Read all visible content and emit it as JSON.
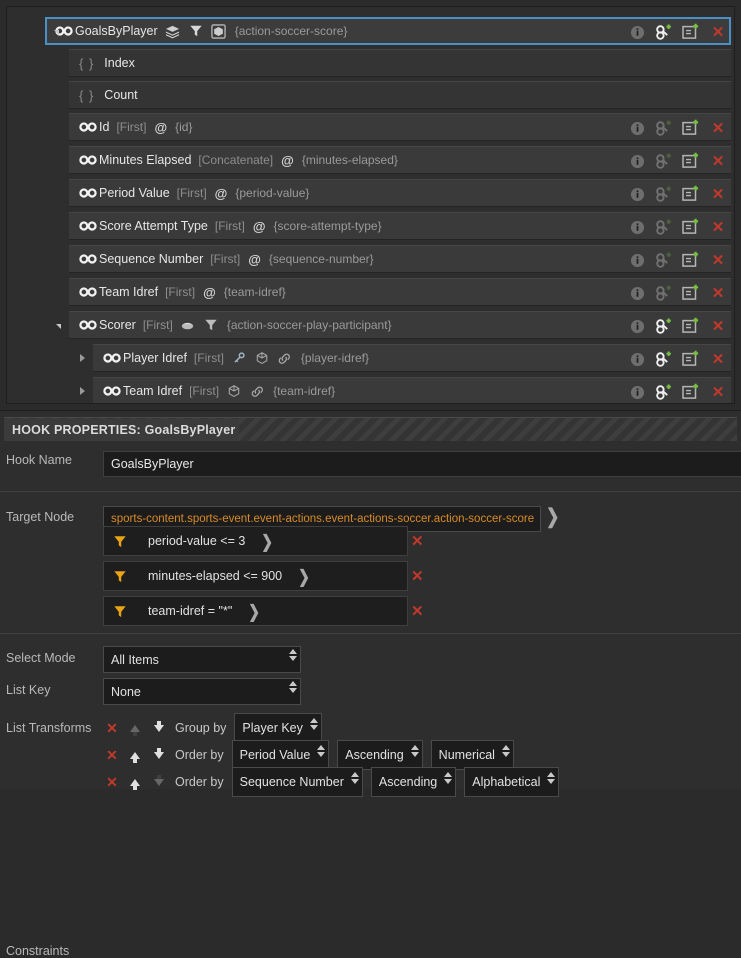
{
  "tree": {
    "root": {
      "label": "GoalsByPlayer",
      "icons": [
        "link-chain-icon",
        "layers-icon",
        "filter-icon",
        "box-icon"
      ],
      "xpath": "{action-soccer-score}",
      "selected": true,
      "expanded": true
    },
    "rows": [
      {
        "kind": "braces",
        "braces": "{ }",
        "label": "Index",
        "indent": 1,
        "actions": false
      },
      {
        "kind": "braces",
        "braces": "{ }",
        "label": "Count",
        "indent": 1,
        "actions": false
      },
      {
        "kind": "field",
        "label": "Id",
        "agg": "[First]",
        "at": "@",
        "xpath": "{id}",
        "indent": 1,
        "actions": true,
        "chain_active": false
      },
      {
        "kind": "field",
        "label": "Minutes Elapsed",
        "agg": "[Concatenate]",
        "at": "@",
        "xpath": "{minutes-elapsed}",
        "indent": 1,
        "actions": true,
        "chain_active": false
      },
      {
        "kind": "field",
        "label": "Period Value",
        "agg": "[First]",
        "at": "@",
        "xpath": "{period-value}",
        "indent": 1,
        "actions": true,
        "chain_active": false
      },
      {
        "kind": "field",
        "label": "Score Attempt Type",
        "agg": "[First]",
        "at": "@",
        "xpath": "{score-attempt-type}",
        "indent": 1,
        "actions": true,
        "chain_active": false
      },
      {
        "kind": "field",
        "label": "Sequence Number",
        "agg": "[First]",
        "at": "@",
        "xpath": "{sequence-number}",
        "indent": 1,
        "actions": true,
        "chain_active": false
      },
      {
        "kind": "field",
        "label": "Team Idref",
        "agg": "[First]",
        "at": "@",
        "xpath": "{team-idref}",
        "indent": 1,
        "actions": true,
        "chain_active": false
      },
      {
        "kind": "group",
        "label": "Scorer",
        "agg": "[First]",
        "icons": [
          "hook-icon",
          "filter-icon"
        ],
        "xpath": "{action-soccer-play-participant}",
        "indent": 1,
        "actions": true,
        "chain_active": true,
        "expanded": true
      },
      {
        "kind": "leaf",
        "label": "Player Idref",
        "agg": "[First]",
        "icons": [
          "key-icon",
          "box-icon",
          "link-icon"
        ],
        "xpath": "{player-idref}",
        "indent": 2,
        "actions": true,
        "chain_active": true,
        "collapsed": true
      },
      {
        "kind": "leaf",
        "label": "Team Idref",
        "agg": "[First]",
        "icons": [
          "box-icon",
          "link-icon"
        ],
        "xpath": "{team-idref}",
        "indent": 2,
        "actions": true,
        "chain_active": true,
        "collapsed": true
      }
    ],
    "row_action_icons": [
      "info-icon",
      "add-chain-icon",
      "add-node-icon",
      "delete-icon"
    ]
  },
  "properties": {
    "header_title": "HOOK PROPERTIES: GoalsByPlayer",
    "hook_name_label": "Hook Name",
    "hook_name_value": "GoalsByPlayer",
    "target_node_label": "Target Node",
    "target_node_value": "sports-content.sports-event.event-actions.event-actions-soccer.action-soccer-score",
    "constraints_label": "Constraints",
    "constraints": [
      {
        "text": "period-value <= 3"
      },
      {
        "text": "minutes-elapsed <= 900"
      },
      {
        "text": "team-idref = \"*\""
      }
    ],
    "select_mode_label": "Select Mode",
    "select_mode_value": "All Items",
    "list_key_label": "List Key",
    "list_key_value": "None",
    "list_transforms_label": "List Transforms",
    "transforms": [
      {
        "verb": "Group by",
        "fields": [
          "Player Key"
        ],
        "up_enabled": false,
        "down_enabled": true
      },
      {
        "verb": "Order by",
        "fields": [
          "Period Value",
          "Ascending",
          "Numerical"
        ],
        "up_enabled": true,
        "down_enabled": true
      },
      {
        "verb": "Order by",
        "fields": [
          "Sequence Number",
          "Ascending",
          "Alphabetical"
        ],
        "up_enabled": true,
        "down_enabled": false
      }
    ]
  },
  "colors": {
    "background": "#2b2b2b",
    "row": "#3a3a3a",
    "selection": "#4a90c4",
    "delete": "#c0392b",
    "filter_yellow": "#e8a317",
    "path_orange": "#d98b28",
    "add_green": "#79c043"
  }
}
